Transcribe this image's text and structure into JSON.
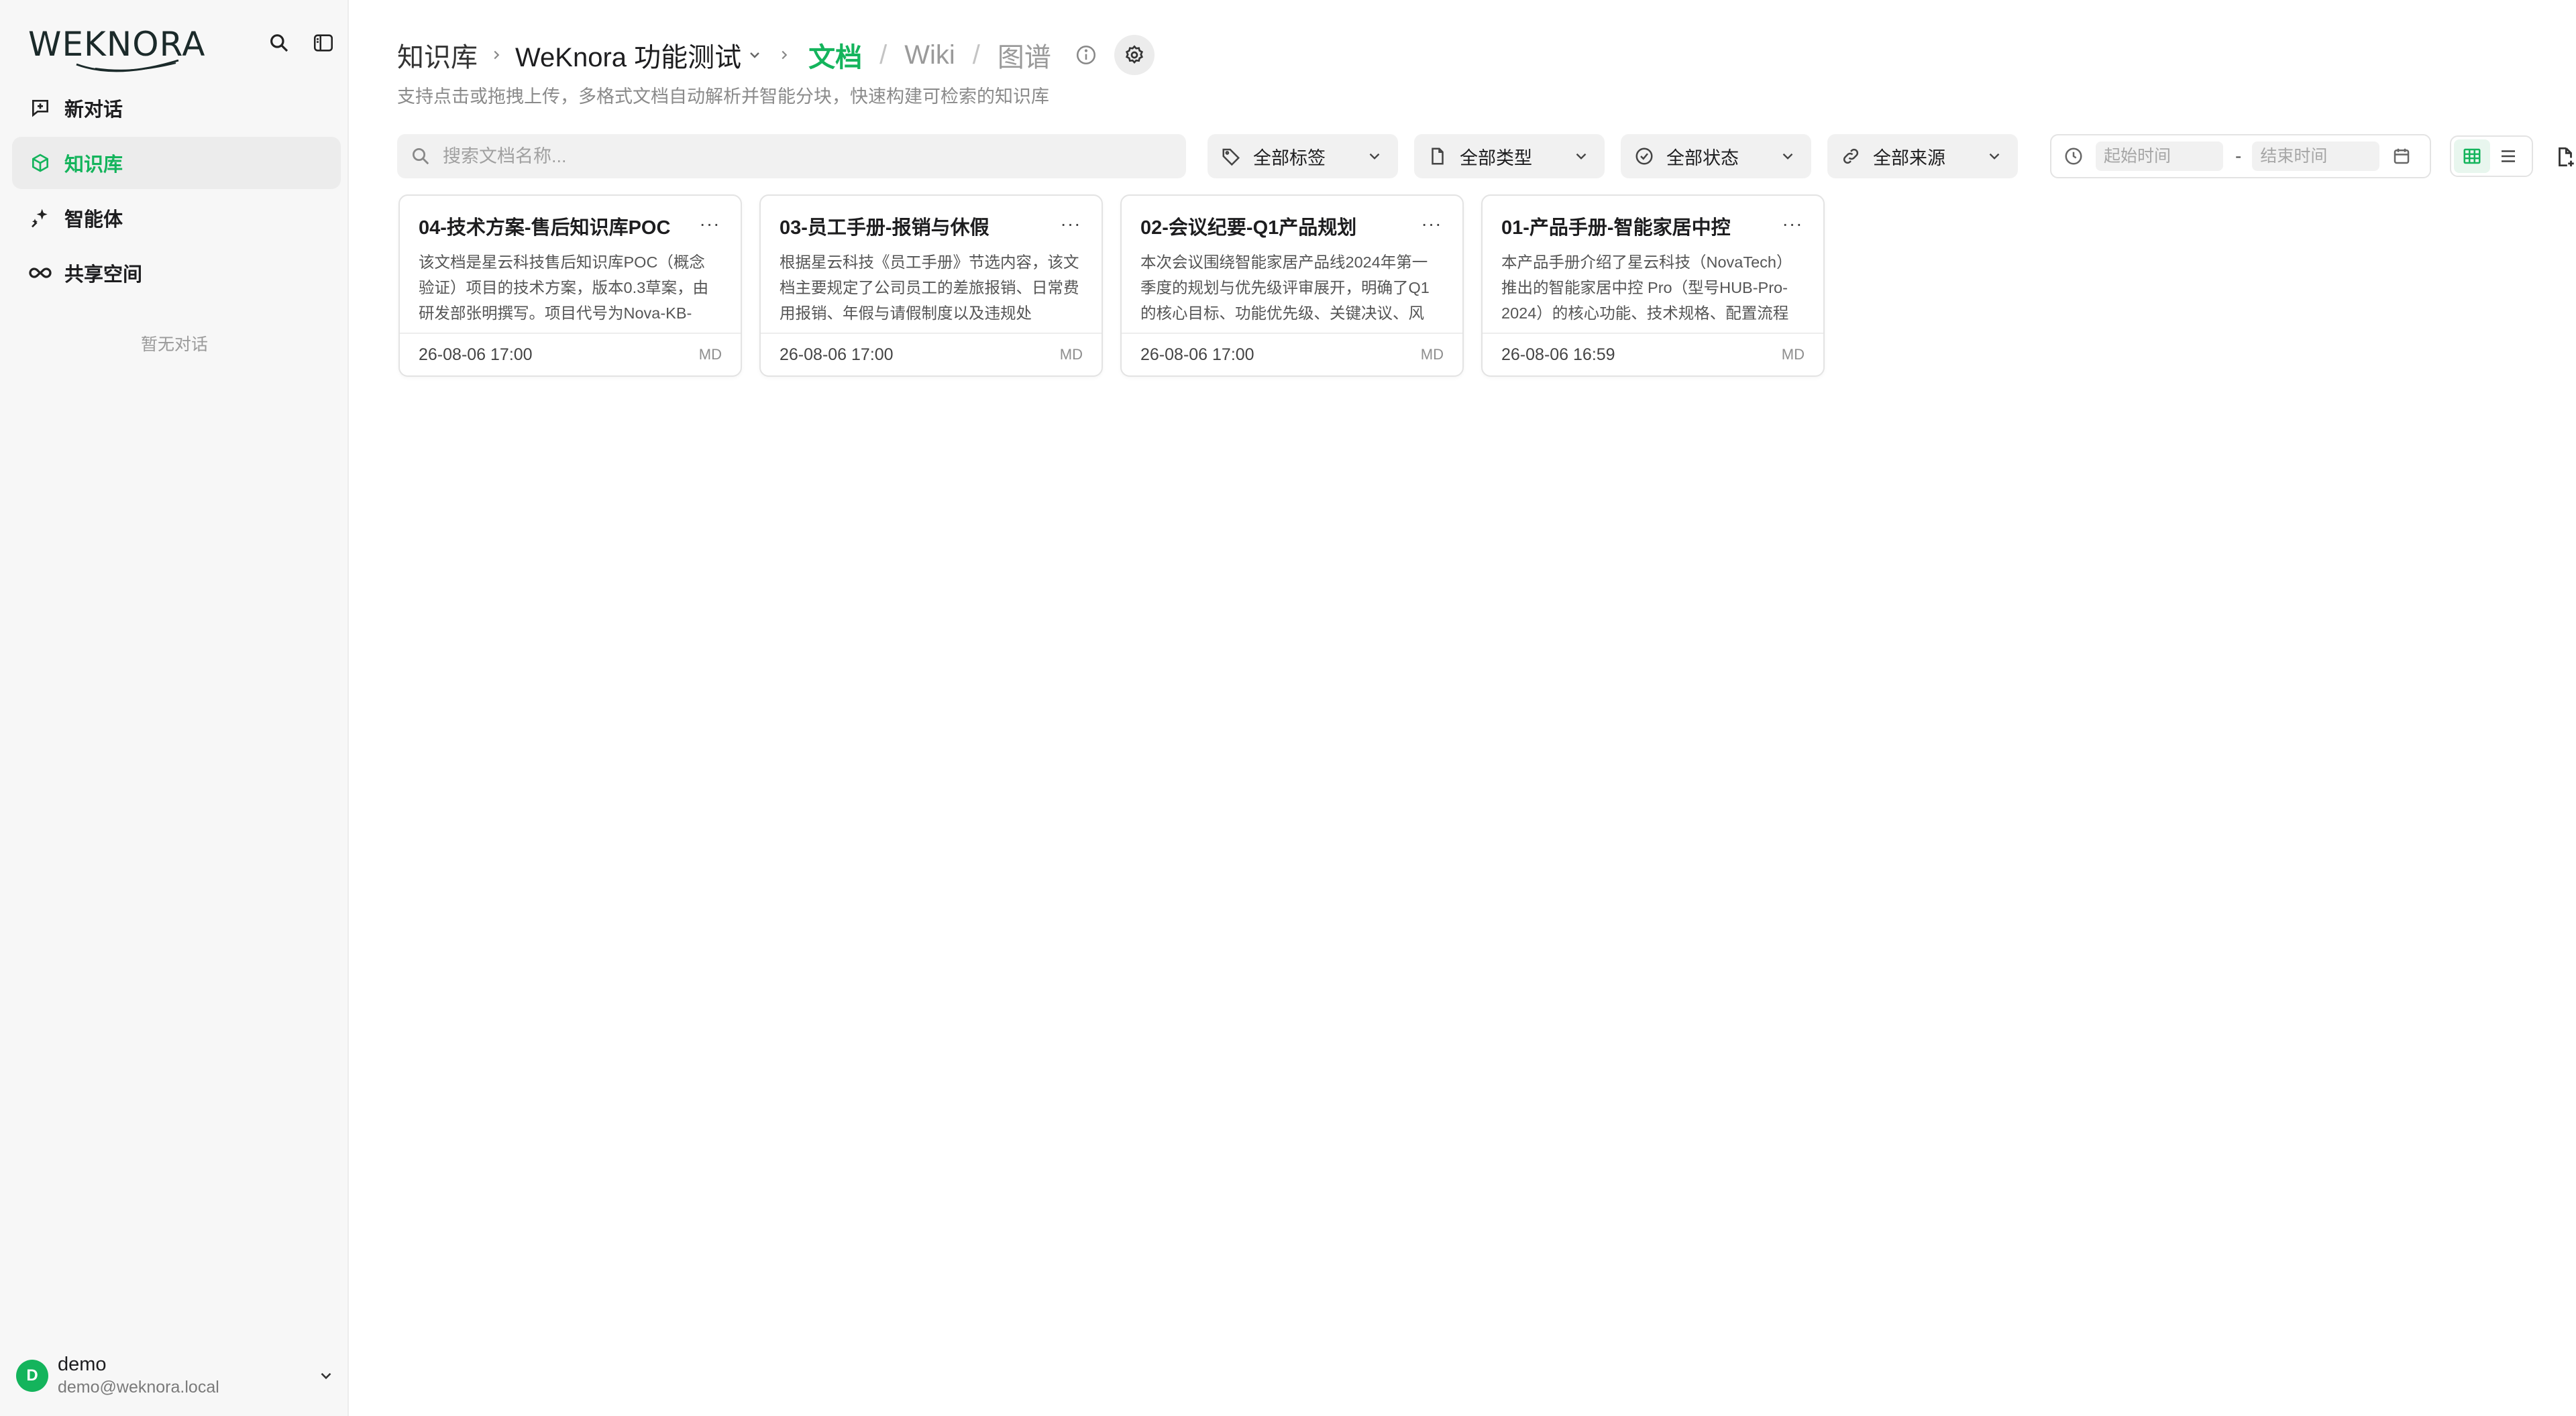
{
  "brand": {
    "logo_text": "WEKNORA",
    "accent_color": "#14b45c"
  },
  "sidebar": {
    "items": [
      {
        "label": "新对话",
        "icon": "chat-plus-icon",
        "active": false
      },
      {
        "label": "知识库",
        "icon": "cube-icon",
        "active": true
      },
      {
        "label": "智能体",
        "icon": "sparkle-icon",
        "active": false
      },
      {
        "label": "共享空间",
        "icon": "infinity-icon",
        "active": false
      }
    ],
    "empty_text": "暂无对话",
    "user": {
      "initial": "D",
      "name": "demo",
      "email": "demo@weknora.local"
    }
  },
  "header": {
    "breadcrumb_root": "知识库",
    "kb_name": "WeKnora 功能测试",
    "tabs": [
      {
        "label": "文档",
        "active": true
      },
      {
        "label": "Wiki",
        "active": false
      },
      {
        "label": "图谱",
        "active": false
      }
    ],
    "subtitle": "支持点击或拖拽上传，多格式文档自动解析并智能分块，快速构建可检索的知识库"
  },
  "toolbar": {
    "search_placeholder": "搜索文档名称...",
    "filters": {
      "tags": "全部标签",
      "types": "全部类型",
      "status": "全部状态",
      "source": "全部来源"
    },
    "date_start_placeholder": "起始时间",
    "date_separator": "-",
    "date_end_placeholder": "结束时间",
    "view_mode": "grid"
  },
  "documents": [
    {
      "title": "04-技术方案-售后知识库POC",
      "desc": "该文档是星云科技售后知识库POC（概念验证）项目的技术方案，版本0.3草案，由研发部张明撰写。项目代号为Nova-KB-",
      "date": "26-08-06 17:00",
      "type": "MD"
    },
    {
      "title": "03-员工手册-报销与休假",
      "desc": "根据星云科技《员工手册》节选内容，该文档主要规定了公司员工的差旅报销、日常费用报销、年假与请假制度以及违规处",
      "date": "26-08-06 17:00",
      "type": "MD"
    },
    {
      "title": "02-会议纪要-Q1产品规划",
      "desc": "本次会议围绕智能家居产品线2024年第一季度的规划与优先级评审展开，明确了Q1的核心目标、功能优先级、关键决议、风",
      "date": "26-08-06 17:00",
      "type": "MD"
    },
    {
      "title": "01-产品手册-智能家居中控",
      "desc": "本产品手册介绍了星云科技（NovaTech）推出的智能家居中控 Pro（型号HUB-Pro-2024）的核心功能、技术规格、配置流程",
      "date": "26-08-06 16:59",
      "type": "MD"
    }
  ]
}
